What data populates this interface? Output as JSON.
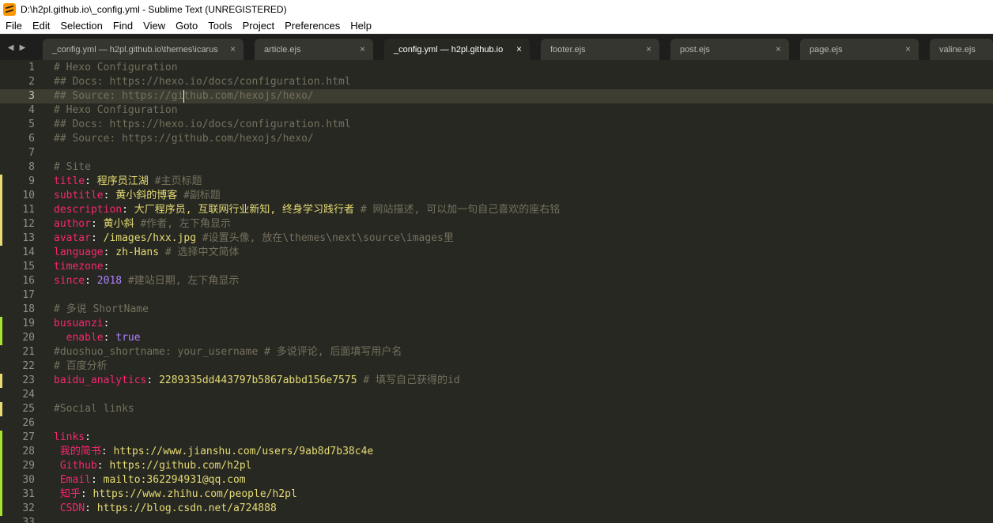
{
  "window": {
    "title": "D:\\h2pl.github.io\\_config.yml - Sublime Text (UNREGISTERED)"
  },
  "menu": [
    "File",
    "Edit",
    "Selection",
    "Find",
    "View",
    "Goto",
    "Tools",
    "Project",
    "Preferences",
    "Help"
  ],
  "tabs": [
    {
      "label": "_config.yml — h2pl.github.io\\themes\\icarus",
      "close": "×",
      "active": false
    },
    {
      "label": "article.ejs",
      "close": "×",
      "active": false
    },
    {
      "label": "_config.yml — h2pl.github.io",
      "close": "×",
      "active": true
    },
    {
      "label": "footer.ejs",
      "close": "×",
      "active": false
    },
    {
      "label": "post.ejs",
      "close": "×",
      "active": false
    },
    {
      "label": "page.ejs",
      "close": "×",
      "active": false
    },
    {
      "label": "valine.ejs",
      "close": "",
      "active": false
    }
  ],
  "tab_nav": "◀ ▶",
  "colors": {
    "background": "#272822",
    "comment": "#75715e",
    "key": "#f92672",
    "string": "#e6db74",
    "number": "#ae81ff",
    "modified_marker": "#e6db74",
    "added_marker": "#a6e22e"
  },
  "lines": [
    {
      "n": "1",
      "parts": [
        [
          "# Hexo Configuration",
          "comment"
        ]
      ]
    },
    {
      "n": "2",
      "parts": [
        [
          "## Docs: https://hexo.io/docs/configuration.html",
          "comment"
        ]
      ]
    },
    {
      "n": "3",
      "parts": [
        [
          "## Source: https://github.com/hexojs/hexo/",
          "comment"
        ]
      ],
      "current": true
    },
    {
      "n": "4",
      "parts": [
        [
          "# Hexo Configuration",
          "comment"
        ]
      ]
    },
    {
      "n": "5",
      "parts": [
        [
          "## Docs: https://hexo.io/docs/configuration.html",
          "comment"
        ]
      ]
    },
    {
      "n": "6",
      "parts": [
        [
          "## Source: https://github.com/hexojs/hexo/",
          "comment"
        ]
      ]
    },
    {
      "n": "7",
      "parts": []
    },
    {
      "n": "8",
      "parts": [
        [
          "# Site",
          "comment"
        ]
      ]
    },
    {
      "n": "9",
      "parts": [
        [
          "title",
          "key"
        ],
        [
          ": ",
          "plain"
        ],
        [
          "程序员江湖 ",
          "str"
        ],
        [
          "#主页标题",
          "comment"
        ]
      ],
      "mark": "modified"
    },
    {
      "n": "10",
      "parts": [
        [
          "subtitle",
          "key"
        ],
        [
          ": ",
          "plain"
        ],
        [
          "黄小斜的博客 ",
          "str"
        ],
        [
          "#副标题",
          "comment"
        ]
      ],
      "mark": "modified"
    },
    {
      "n": "11",
      "parts": [
        [
          "description",
          "key"
        ],
        [
          ": ",
          "plain"
        ],
        [
          "大厂程序员, 互联网行业新知, 终身学习践行者 ",
          "str"
        ],
        [
          "# 网站描述, 可以加一句自己喜欢的座右铭",
          "comment"
        ]
      ],
      "mark": "modified"
    },
    {
      "n": "12",
      "parts": [
        [
          "author",
          "key"
        ],
        [
          ": ",
          "plain"
        ],
        [
          "黄小斜 ",
          "str"
        ],
        [
          "#作者, 左下角显示",
          "comment"
        ]
      ],
      "mark": "modified"
    },
    {
      "n": "13",
      "parts": [
        [
          "avatar",
          "key"
        ],
        [
          ": ",
          "plain"
        ],
        [
          "/images/hxx.jpg ",
          "str"
        ],
        [
          "#设置头像, 放在\\themes\\next\\source\\images里",
          "comment"
        ]
      ],
      "mark": "modified"
    },
    {
      "n": "14",
      "parts": [
        [
          "language",
          "key"
        ],
        [
          ": ",
          "plain"
        ],
        [
          "zh-Hans ",
          "str"
        ],
        [
          "# 选择中文简体",
          "comment"
        ]
      ]
    },
    {
      "n": "15",
      "parts": [
        [
          "timezone",
          "key"
        ],
        [
          ":",
          "plain"
        ]
      ]
    },
    {
      "n": "16",
      "parts": [
        [
          "since",
          "key"
        ],
        [
          ": ",
          "plain"
        ],
        [
          "2018",
          "num"
        ],
        [
          " #建站日期, 左下角显示",
          "comment"
        ]
      ]
    },
    {
      "n": "17",
      "parts": []
    },
    {
      "n": "18",
      "parts": [
        [
          "# 多说 ShortName",
          "comment"
        ]
      ]
    },
    {
      "n": "19",
      "parts": [
        [
          "busuanzi",
          "key"
        ],
        [
          ":",
          "plain"
        ]
      ],
      "mark": "added"
    },
    {
      "n": "20",
      "parts": [
        [
          "  ",
          "plain"
        ],
        [
          "enable",
          "key"
        ],
        [
          ": ",
          "plain"
        ],
        [
          "true",
          "num"
        ]
      ],
      "mark": "added"
    },
    {
      "n": "21",
      "parts": [
        [
          "#duoshuo_shortname: your_username # 多说评论, 后面填写用户名",
          "comment"
        ]
      ]
    },
    {
      "n": "22",
      "parts": [
        [
          "# 百度分析",
          "comment"
        ]
      ]
    },
    {
      "n": "23",
      "parts": [
        [
          "baidu_analytics",
          "key"
        ],
        [
          ": ",
          "plain"
        ],
        [
          "2289335dd443797b5867abbd156e7575 ",
          "str"
        ],
        [
          "# 填写自己获得的id",
          "comment"
        ]
      ],
      "mark": "modified"
    },
    {
      "n": "24",
      "parts": []
    },
    {
      "n": "25",
      "parts": [
        [
          "#Social links",
          "comment"
        ]
      ],
      "mark": "modified"
    },
    {
      "n": "26",
      "parts": []
    },
    {
      "n": "27",
      "parts": [
        [
          "links",
          "key"
        ],
        [
          ":",
          "plain"
        ]
      ],
      "mark": "added"
    },
    {
      "n": "28",
      "parts": [
        [
          " ",
          "plain"
        ],
        [
          "我的简书",
          "key"
        ],
        [
          ": ",
          "plain"
        ],
        [
          "https://www.jianshu.com/users/9ab8d7b38c4e",
          "str"
        ]
      ],
      "mark": "added"
    },
    {
      "n": "29",
      "parts": [
        [
          " ",
          "plain"
        ],
        [
          "Github",
          "key"
        ],
        [
          ": ",
          "plain"
        ],
        [
          "https://github.com/h2pl",
          "str"
        ]
      ],
      "mark": "added"
    },
    {
      "n": "30",
      "parts": [
        [
          " ",
          "plain"
        ],
        [
          "Email",
          "key"
        ],
        [
          ": ",
          "plain"
        ],
        [
          "mailto:362294931@qq.com",
          "str"
        ]
      ],
      "mark": "added"
    },
    {
      "n": "31",
      "parts": [
        [
          " ",
          "plain"
        ],
        [
          "知乎",
          "key"
        ],
        [
          ": ",
          "plain"
        ],
        [
          "https://www.zhihu.com/people/h2pl",
          "str"
        ]
      ],
      "mark": "added"
    },
    {
      "n": "32",
      "parts": [
        [
          " ",
          "plain"
        ],
        [
          "CSDN",
          "key"
        ],
        [
          ": ",
          "plain"
        ],
        [
          "https://blog.csdn.net/a724888",
          "str"
        ]
      ],
      "mark": "added"
    },
    {
      "n": "33",
      "parts": []
    }
  ]
}
